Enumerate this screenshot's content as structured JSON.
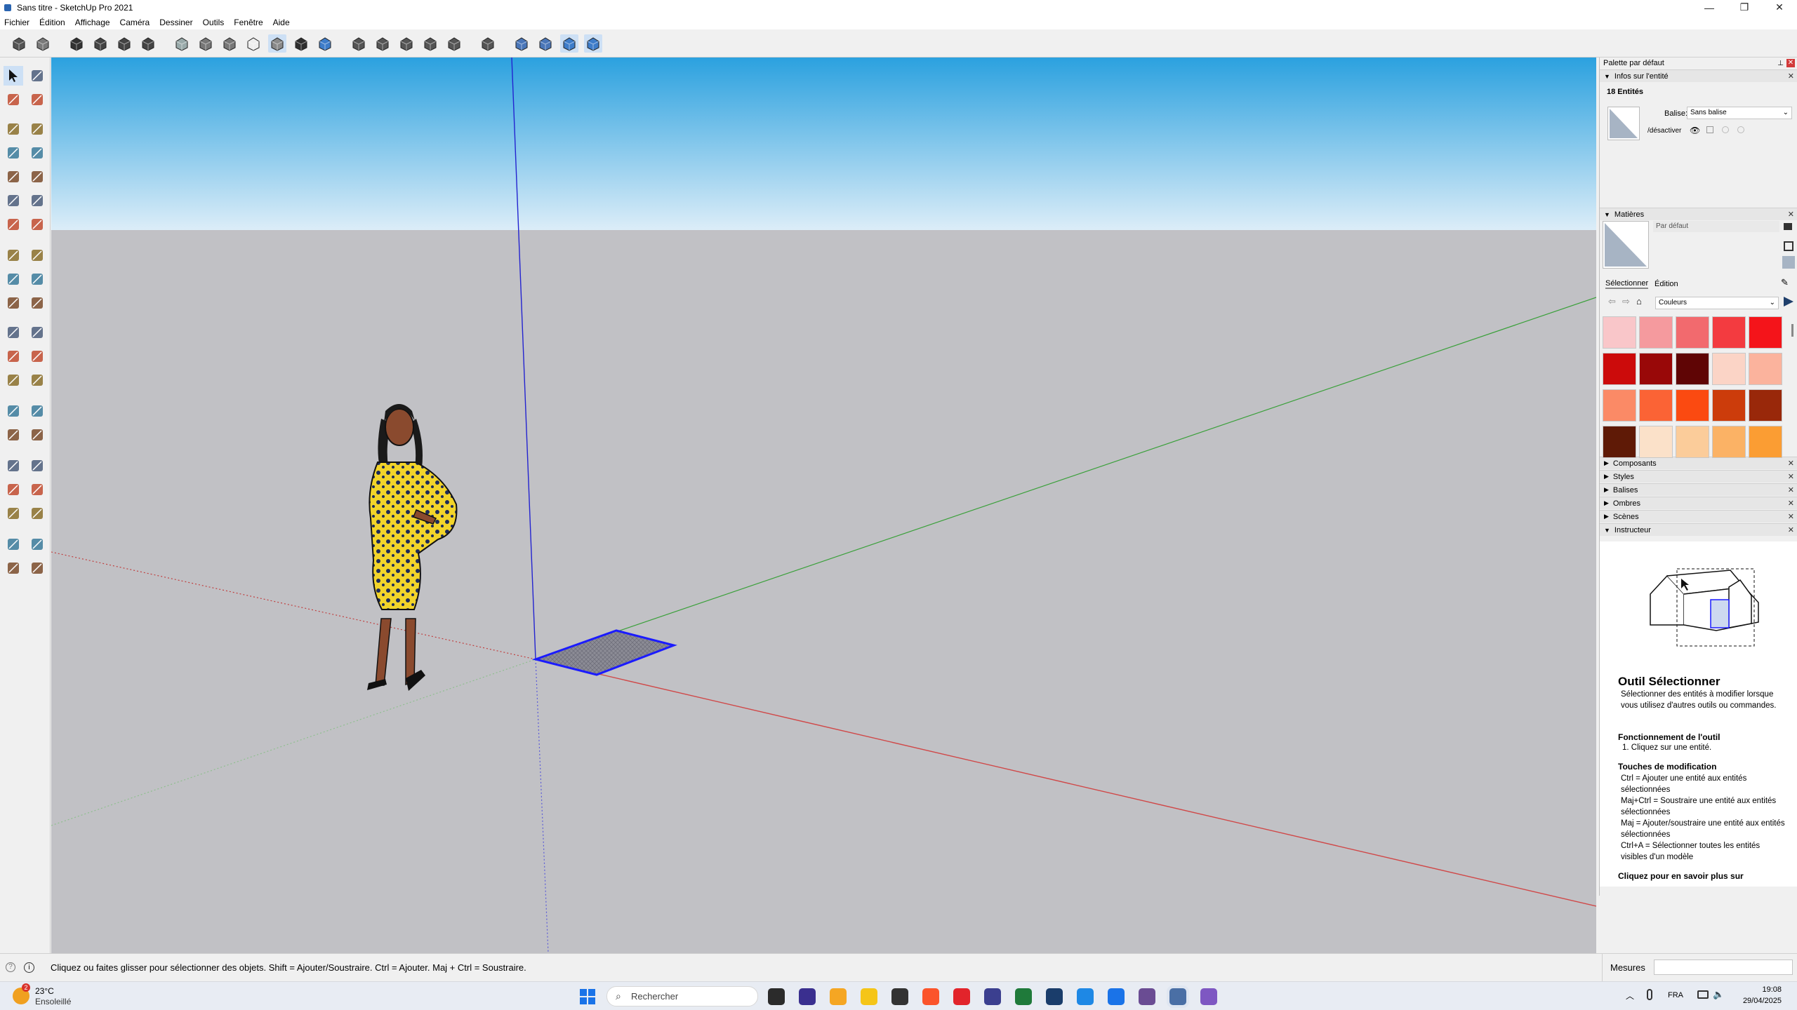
{
  "window": {
    "title": "Sans titre - SketchUp Pro 2021",
    "controls": [
      "—",
      "❐",
      "✕"
    ]
  },
  "menu": [
    "Fichier",
    "Édition",
    "Affichage",
    "Caméra",
    "Dessiner",
    "Outils",
    "Fenêtre",
    "Aide"
  ],
  "toolbar": {
    "icons": [
      "3d-warehouse-icon",
      "extension-warehouse-icon",
      "iso-view-icon",
      "top-view-icon",
      "front-view-icon",
      "right-view-icon",
      "xray-style-icon",
      "back-edges-style-icon",
      "wireframe-style-icon",
      "hidden-line-style-icon",
      "shaded-style-icon",
      "shaded-textures-style-icon",
      "monochrome-style-icon",
      "section-plane-icon",
      "display-section-planes-icon",
      "display-section-cuts-icon",
      "display-section-fill-icon",
      "section-toggle-icon",
      "axes-icon",
      "follow-me-icon",
      "sandbox-icon",
      "sandbox-stamp-icon",
      "orbit-toolbar-icon"
    ],
    "active": [
      10,
      21,
      22
    ]
  },
  "left_tools": [
    "select-icon",
    "component-icon",
    "paint-bucket-icon",
    "eraser-icon",
    "pencil-line-icon",
    "freehand-icon",
    "rectangle-icon",
    "rotated-rectangle-icon",
    "circle-icon",
    "polygon-icon",
    "arc-icon",
    "pie-icon",
    "arc-2pt-icon",
    "three-point-arc-icon",
    "move-icon",
    "push-pull-icon",
    "rotate-icon",
    "follow-me-icon",
    "scale-icon",
    "offset-icon",
    "tape-measure-icon",
    "dimension-icon",
    "protractor-icon",
    "text-icon",
    "axes-tool-icon",
    "3d-text-icon",
    "orbit-icon",
    "pan-icon",
    "zoom-icon",
    "zoom-window-icon",
    "zoom-extents-icon",
    "previous-view-icon",
    "position-camera-icon",
    "look-around-icon",
    "walk-icon",
    "section-plane-tool-icon",
    "sandbox-from-contours-icon",
    "sandbox-from-scratch-icon",
    "smoove-icon",
    "stamp-icon"
  ],
  "panel": {
    "title": "Palette par défaut",
    "entity_info": {
      "header": "Infos sur l'entité",
      "count": "18 Entités",
      "tag_label": "Balise:",
      "tag_value": "Sans balise",
      "toggle_label": "/désactiver"
    },
    "materials": {
      "header": "Matières",
      "default_name": "Par défaut",
      "tabs": [
        "Sélectionner",
        "Édition"
      ],
      "library": "Couleurs",
      "swatches": [
        "#f9c6c9",
        "#f59a9e",
        "#f26a6e",
        "#f33b40",
        "#f4141a",
        "#cc0b0b",
        "#990808",
        "#5f0505",
        "#fbd4c6",
        "#fbb39d",
        "#fb8a66",
        "#fb6335",
        "#fb4a11",
        "#cc3c0b",
        "#99280a",
        "#5f1a06",
        "#fbe1c9",
        "#fbcc9a",
        "#fbb265",
        "#fb9d33"
      ]
    },
    "collapsed": [
      "Composants",
      "Styles",
      "Balises",
      "Ombres",
      "Scènes"
    ],
    "instructor": {
      "header": "Instructeur",
      "tool_title": "Outil Sélectionner",
      "desc": "Sélectionner des entités à modifier lorsque vous utilisez d'autres outils ou commandes.",
      "op_title": "Fonctionnement de l'outil",
      "op_steps": "1. Cliquez sur une entité.",
      "mod_title": "Touches de modification",
      "mods": [
        "Ctrl = Ajouter une entité aux entités sélectionnées",
        "Maj+Ctrl = Soustraire une entité aux entités sélectionnées",
        "Maj = Ajouter/soustraire une entité aux entités sélectionnées",
        "Ctrl+A = Sélectionner toutes les entités visibles d'un modèle"
      ],
      "more": "Cliquez pour en savoir plus sur"
    }
  },
  "status": {
    "message": "Cliquez ou faites glisser pour sélectionner des objets. Shift = Ajouter/Soustraire. Ctrl = Ajouter. Maj + Ctrl = Soustraire.",
    "measures_label": "Mesures",
    "measures_value": ""
  },
  "taskbar": {
    "weather_temp": "23°C",
    "weather_desc": "Ensoleillé",
    "weather_badge": "2",
    "search_placeholder": "Rechercher",
    "lang": "FRA",
    "time": "19:08",
    "date": "29/04/2025",
    "app_colors": [
      "#2b2b2b",
      "#3a2f8f",
      "#f5a623",
      "#f5c518",
      "#333333",
      "#fb542b",
      "#e2242b",
      "#3b3f8f",
      "#1f7a3a",
      "#1a3d6b",
      "#1e88e5",
      "#1a73e8",
      "#6a4c93",
      "#4a6fa5",
      "#7e57c2"
    ]
  }
}
